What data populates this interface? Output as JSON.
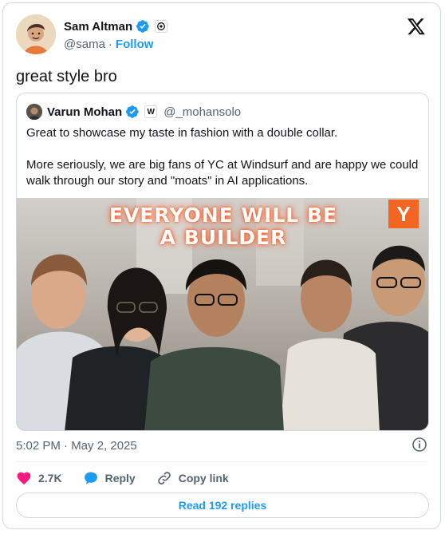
{
  "author": {
    "name": "Sam Altman",
    "handle": "@sama",
    "follow_label": "Follow",
    "verified_color": "#1d9bf0"
  },
  "tweet": {
    "text": "great style bro",
    "timestamp": "5:02 PM · May 2, 2025"
  },
  "quoted": {
    "name": "Varun Mohan",
    "affiliate_badge": "W",
    "handle": "@_mohansolo",
    "paragraphs": [
      "Great to showcase my taste in fashion with a double collar.",
      "More seriously, we are big fans of YC at Windsurf and are happy we could walk through our story and \"moats\" in AI applications."
    ],
    "media": {
      "headline_line1": "EVERYONE WILL BE",
      "headline_line2": "A BUILDER",
      "badge_letter": "Y",
      "badge_color": "#f26522"
    }
  },
  "actions": {
    "likes": "2.7K",
    "reply_label": "Reply",
    "copy_link_label": "Copy link"
  },
  "read_replies_label": "Read 192 replies",
  "colors": {
    "accent": "#1d9bf0",
    "like": "#f91880",
    "secondary_text": "#536471",
    "border": "#cfd9de"
  }
}
